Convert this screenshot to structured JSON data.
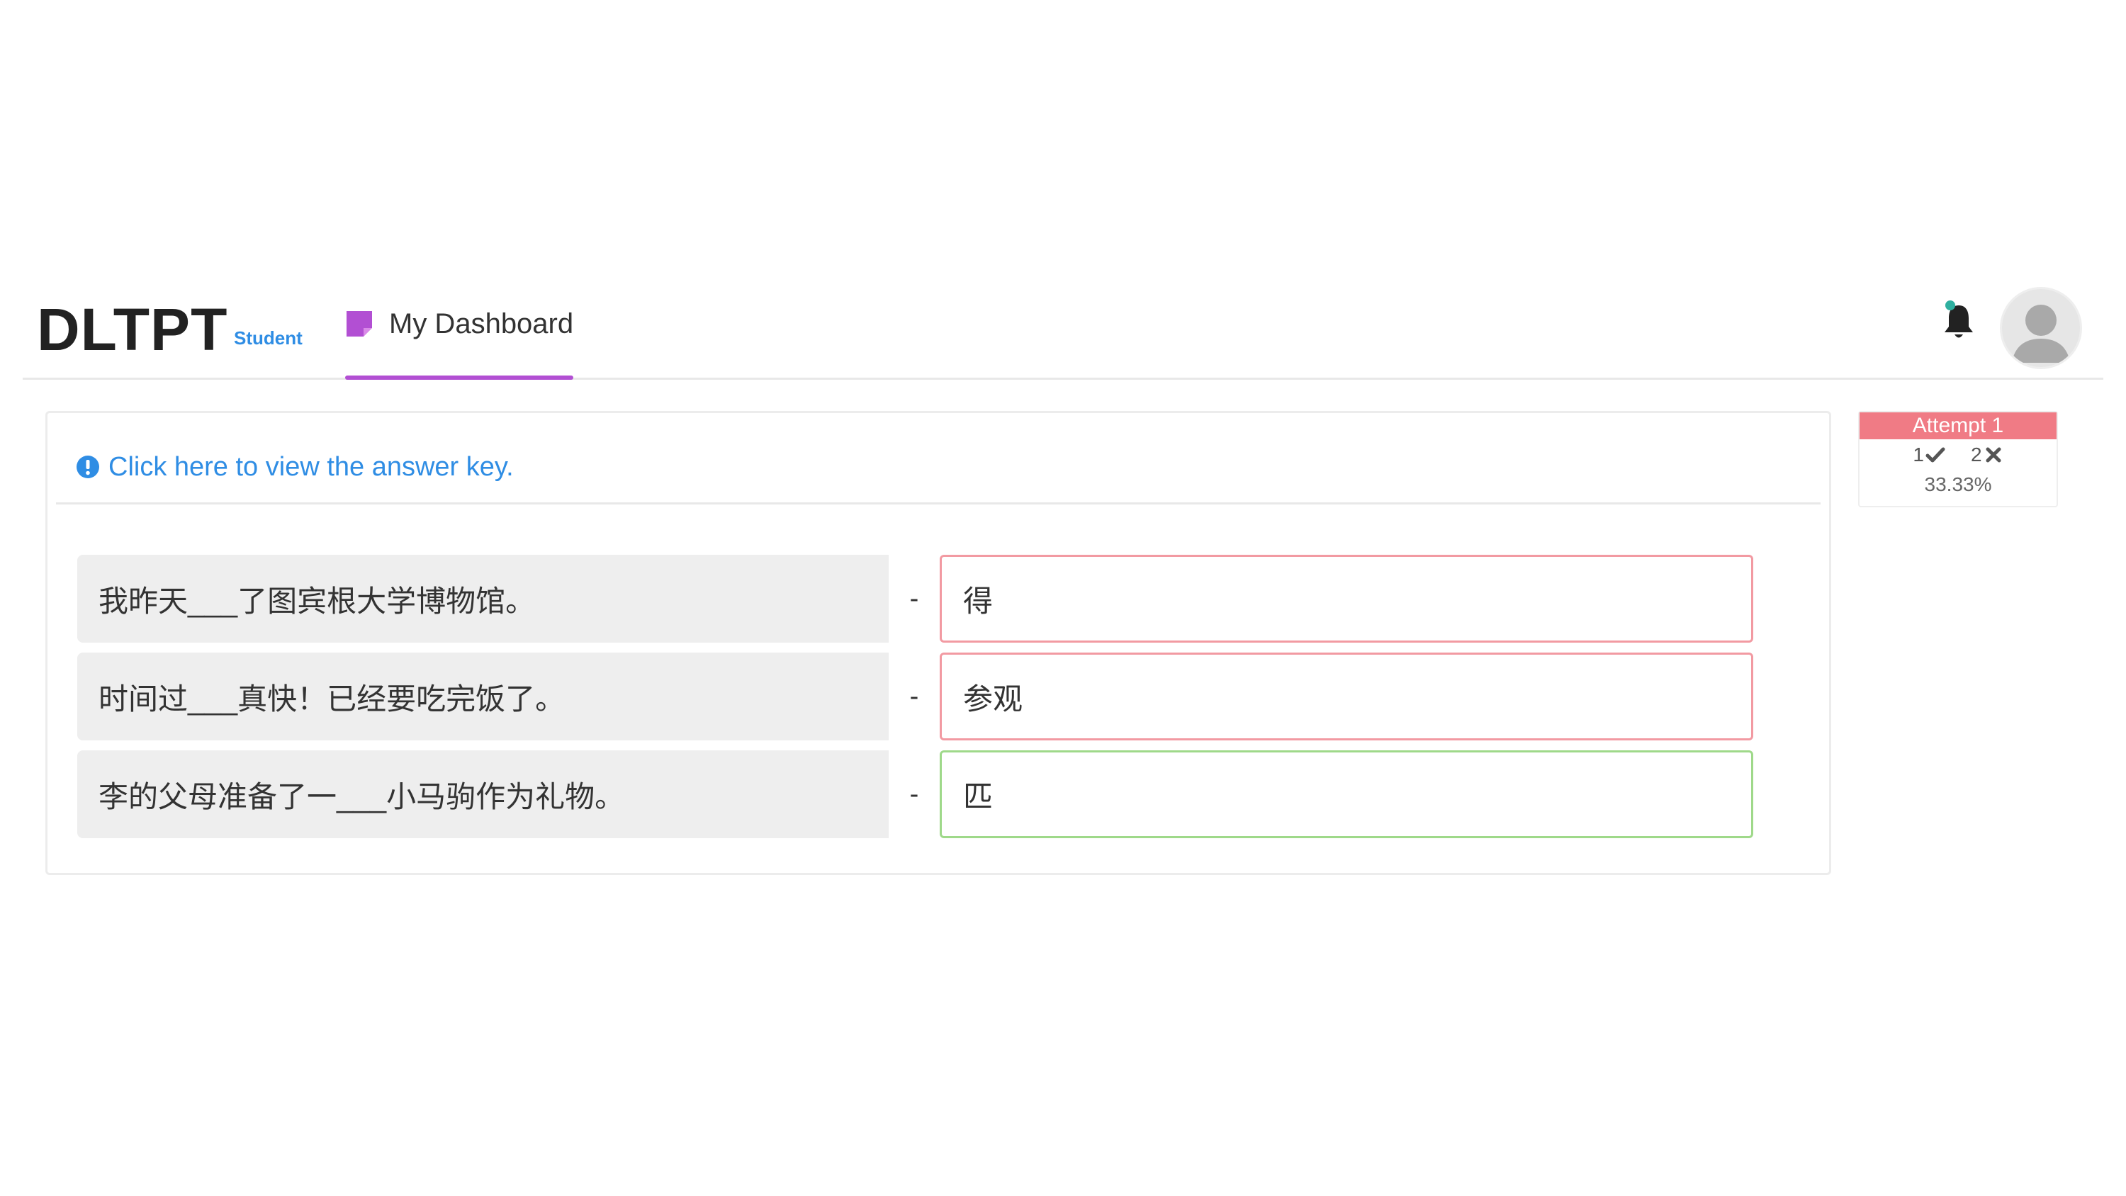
{
  "header": {
    "brand": "DLTPT",
    "role": "Student",
    "tab_label": "My Dashboard",
    "tab_icon": "note-icon",
    "accent_color": "#b24fd3"
  },
  "notice": {
    "link_text": "Click here to view the answer key.",
    "icon": "info-circle-icon",
    "link_color": "#2f8de4"
  },
  "questions": [
    {
      "prompt": "我昨天___了图宾根大学博物馆。",
      "separator": "-",
      "answer": "得",
      "status": "incorrect"
    },
    {
      "prompt": "时间过___真快！已经要吃完饭了。",
      "separator": "-",
      "answer": "参观",
      "status": "incorrect"
    },
    {
      "prompt": "李的父母准备了一___小马驹作为礼物。",
      "separator": "-",
      "answer": "匹",
      "status": "correct"
    }
  ],
  "attempt": {
    "title": "Attempt 1",
    "correct_count": "1",
    "incorrect_count": "2",
    "score": "33.33%",
    "title_bg": "#f07b85",
    "incorrect_border": "#f29aa2",
    "correct_border": "#9fd98a"
  }
}
